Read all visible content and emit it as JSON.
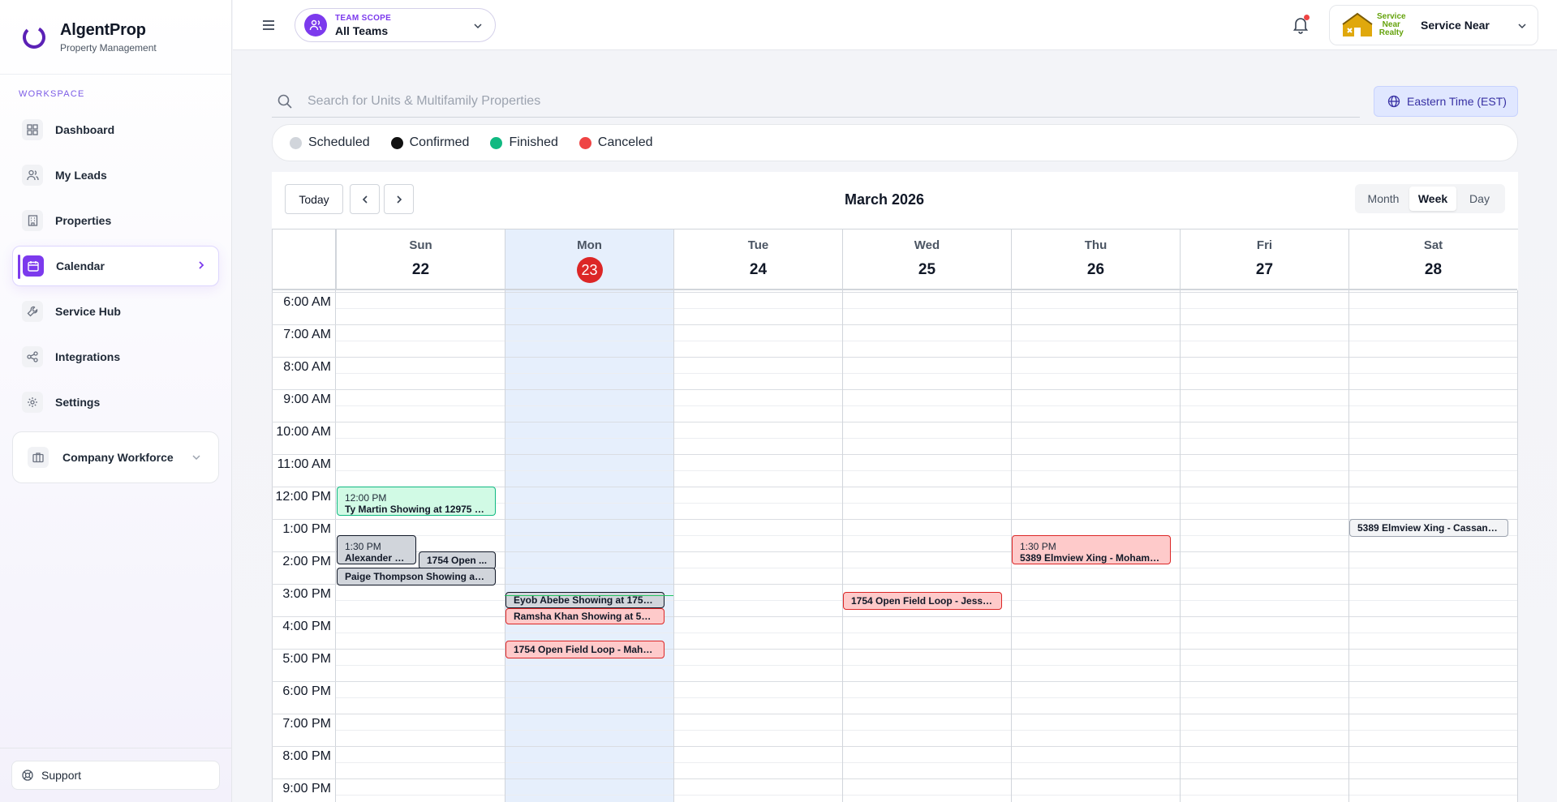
{
  "brand": {
    "name": "AlgentProp",
    "subtitle": "Property Management"
  },
  "sidebar": {
    "section_label": "WORKSPACE",
    "items": [
      {
        "label": "Dashboard",
        "icon": "dashboard-icon"
      },
      {
        "label": "My Leads",
        "icon": "users-icon"
      },
      {
        "label": "Properties",
        "icon": "building-icon"
      },
      {
        "label": "Calendar",
        "icon": "calendar-icon",
        "active": true
      },
      {
        "label": "Service Hub",
        "icon": "wrench-icon"
      },
      {
        "label": "Integrations",
        "icon": "share-icon"
      },
      {
        "label": "Settings",
        "icon": "gear-icon"
      }
    ],
    "workforce_label": "Company Workforce",
    "support_label": "Support"
  },
  "header": {
    "team_scope_label": "TEAM SCOPE",
    "team_scope_value": "All Teams",
    "company_logo_lines": [
      "Service",
      "Near",
      "Realty"
    ],
    "company_name": "Service Near",
    "notification_dot": true
  },
  "search": {
    "placeholder": "Search for Units & Multifamily Properties"
  },
  "timezone_label": "Eastern Time (EST)",
  "legend": [
    {
      "label": "Scheduled",
      "color": "#d1d5db"
    },
    {
      "label": "Confirmed",
      "color": "#111111"
    },
    {
      "label": "Finished",
      "color": "#10b981"
    },
    {
      "label": "Canceled",
      "color": "#ef4444"
    }
  ],
  "calendar": {
    "today_label": "Today",
    "title": "March 2026",
    "views": [
      "Month",
      "Week",
      "Day"
    ],
    "active_view": "Week",
    "days": [
      {
        "name": "Sun",
        "num": "22"
      },
      {
        "name": "Mon",
        "num": "23",
        "today": true
      },
      {
        "name": "Tue",
        "num": "24"
      },
      {
        "name": "Wed",
        "num": "25"
      },
      {
        "name": "Thu",
        "num": "26"
      },
      {
        "name": "Fri",
        "num": "27"
      },
      {
        "name": "Sat",
        "num": "28"
      }
    ],
    "hours": [
      "6:00 AM",
      "7:00 AM",
      "8:00 AM",
      "9:00 AM",
      "10:00 AM",
      "11:00 AM",
      "12:00 PM",
      "1:00 PM",
      "2:00 PM",
      "3:00 PM",
      "4:00 PM",
      "5:00 PM",
      "6:00 PM",
      "7:00 PM",
      "8:00 PM",
      "9:00 PM"
    ],
    "events": [
      {
        "day": 0,
        "start": "12:00 PM",
        "status": "finished",
        "time_label": "12:00 PM",
        "title": "Ty Martin Showing at 12975 W..."
      },
      {
        "day": 0,
        "start": "1:30 PM",
        "status": "confirmed",
        "time_label": "1:30 PM",
        "title": "Alexander W..."
      },
      {
        "day": 0,
        "start": "2:00 PM",
        "status": "confirmed",
        "time_label": "",
        "title": "1754 Open ..."
      },
      {
        "day": 0,
        "start": "2:30 PM",
        "status": "confirmed",
        "time_label": "",
        "title": "Paige Thompson Showing at 1..."
      },
      {
        "day": 1,
        "start": "3:15 PM",
        "status": "confirmed",
        "time_label": "",
        "title": "Eyob Abebe Showing at 1754 ..."
      },
      {
        "day": 1,
        "start": "3:45 PM",
        "status": "canceled",
        "time_label": "",
        "title": "Ramsha Khan Showing at 5530..."
      },
      {
        "day": 1,
        "start": "4:45 PM",
        "status": "canceled",
        "time_label": "",
        "title": "1754 Open Field Loop - Mahes..."
      },
      {
        "day": 3,
        "start": "3:15 PM",
        "status": "canceled",
        "time_label": "",
        "title": "1754 Open Field Loop - Jessic..."
      },
      {
        "day": 4,
        "start": "1:30 PM",
        "status": "canceled",
        "time_label": "1:30 PM",
        "title": "5389 Elmview Xing - Mohamad..."
      },
      {
        "day": 6,
        "start": "1:00 PM",
        "status": "scheduled",
        "time_label": "",
        "title": "5389 Elmview Xing - Cassandr..."
      }
    ]
  }
}
